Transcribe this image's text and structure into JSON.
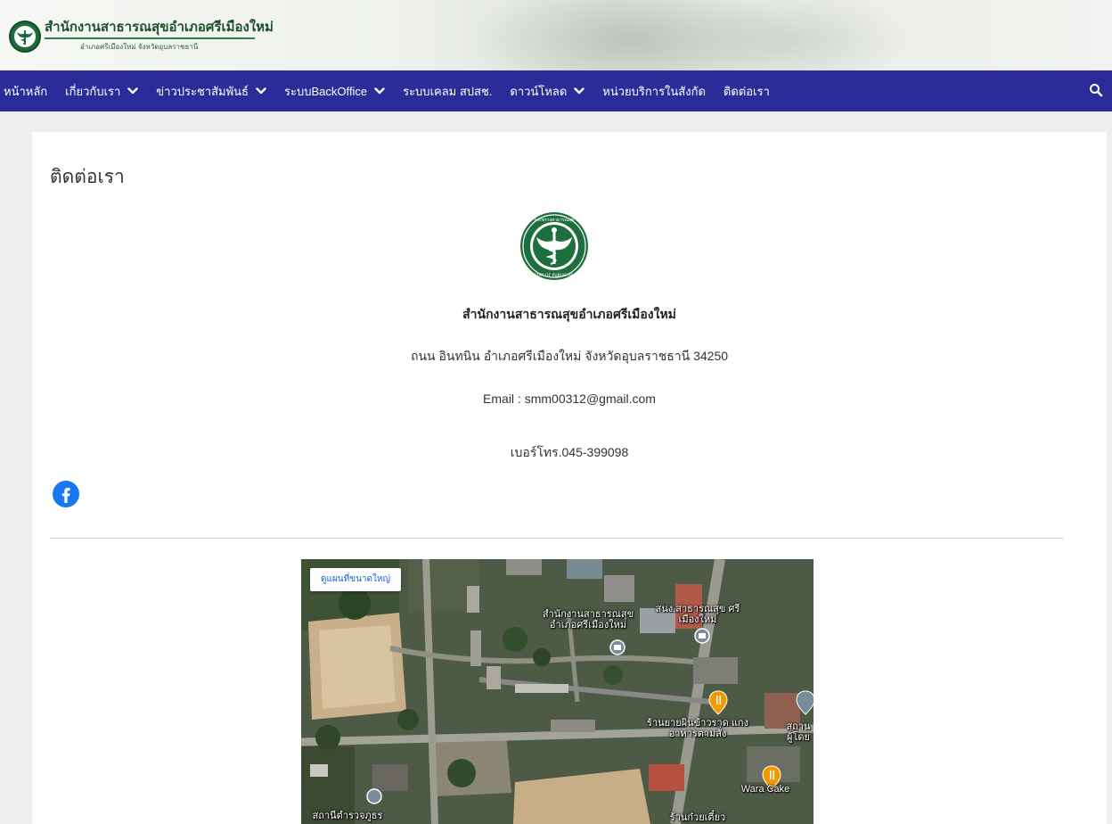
{
  "header": {
    "site_title": "สำนักงานสาธารณสุขอำเภอศรีเมืองใหม่",
    "site_subtitle": "อำเภอศรีเมืองใหม่ จังหวัดอุบลราชธานี"
  },
  "nav": {
    "items": [
      {
        "label": "หน้าหลัก",
        "has_dropdown": false
      },
      {
        "label": "เกี่ยวกับเรา",
        "has_dropdown": true
      },
      {
        "label": "ข่าวประชาสัมพันธ์",
        "has_dropdown": true
      },
      {
        "label": "ระบบBackOffice",
        "has_dropdown": true
      },
      {
        "label": "ระบบเคลม สปสช.",
        "has_dropdown": false
      },
      {
        "label": "ดาวน์โหลด",
        "has_dropdown": true
      },
      {
        "label": "หน่วยบริการในสังกัด",
        "has_dropdown": false
      },
      {
        "label": "ติดต่อเรา",
        "has_dropdown": false
      }
    ],
    "search_icon": "search-icon"
  },
  "content": {
    "page_title": "ติดต่อเรา",
    "org_name": "สำนักงานสาธารณสุขอำเภอศรีเมืองใหม่",
    "address": "ถนน อินทนิน อำเภอศรีเมืองใหม่ จังหวัดอุบลราชธานี 34250",
    "email": "Email : smm00312@gmail.com",
    "phone": "เบอร์โทร.045-399098",
    "social_icon": "facebook-icon"
  },
  "map": {
    "view_larger_label": "ดูแผนที่ขนาดใหญ่",
    "labels": {
      "office": "สำนักงานสาธารณสุข อำเภอศรีเมืองใหม่",
      "office_short": "สนง.สาธารณสุข ศรีเมืองใหม่",
      "restaurant": "ร้านยายผินข้าวราด แกงอาหารตามสั่ง",
      "cake": "Wara Cake",
      "station": "สถานีตำรวจภูธร",
      "edge": "สถาน ผู้โดย",
      "edge_bottom": "ร้านก๋วยเตี๋ยว"
    },
    "colors": {
      "poi_orange": "#f29900",
      "poi_gray": "#7a8b99"
    }
  },
  "colors": {
    "nav_bg": "#2b2c97",
    "facebook_blue": "#1877f2",
    "brand_green": "#1d6b3c"
  }
}
